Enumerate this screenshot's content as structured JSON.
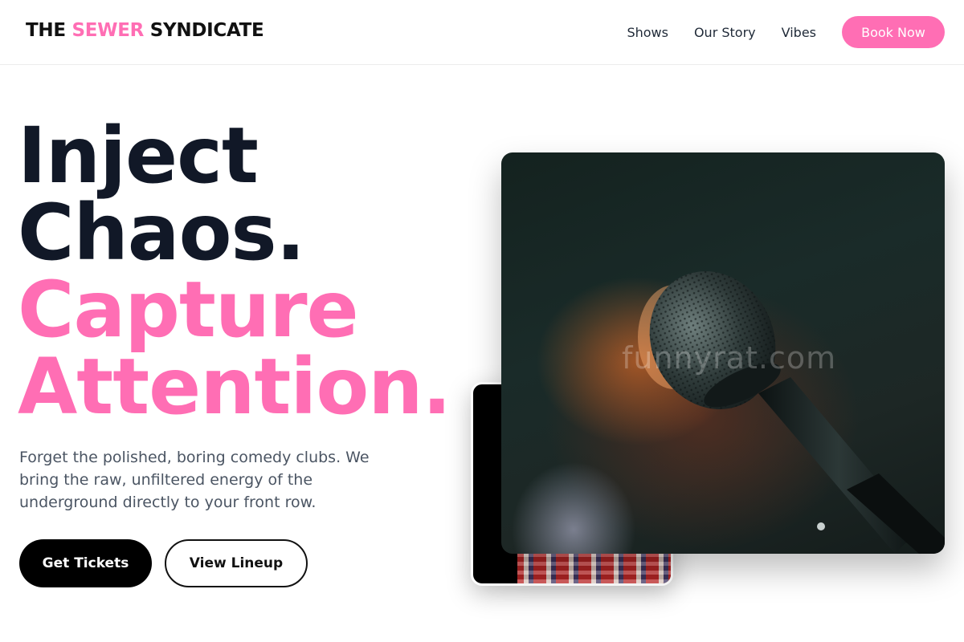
{
  "header": {
    "logo_part1": "THE ",
    "logo_accent": "SEWER",
    "logo_part2": " SYNDICATE",
    "nav": [
      "Shows",
      "Our Story",
      "Vibes"
    ],
    "cta": "Book Now"
  },
  "hero": {
    "headline_lines": [
      "Inject",
      "Chaos.",
      "Capture",
      "Attention."
    ],
    "subtext": "Forget the polished, boring comedy clubs. We bring the raw, unfiltered energy of the underground directly to your front row.",
    "primary_button": "Get Tickets",
    "secondary_button": "View Lineup"
  },
  "images": {
    "main_watermark": "funnyrat.com",
    "main_subject": "microphone",
    "secondary_subject": "performer in plaid shirt"
  },
  "colors": {
    "accent": "#ff6eb4",
    "dark_text": "#111827",
    "body_text": "#4b5563"
  }
}
